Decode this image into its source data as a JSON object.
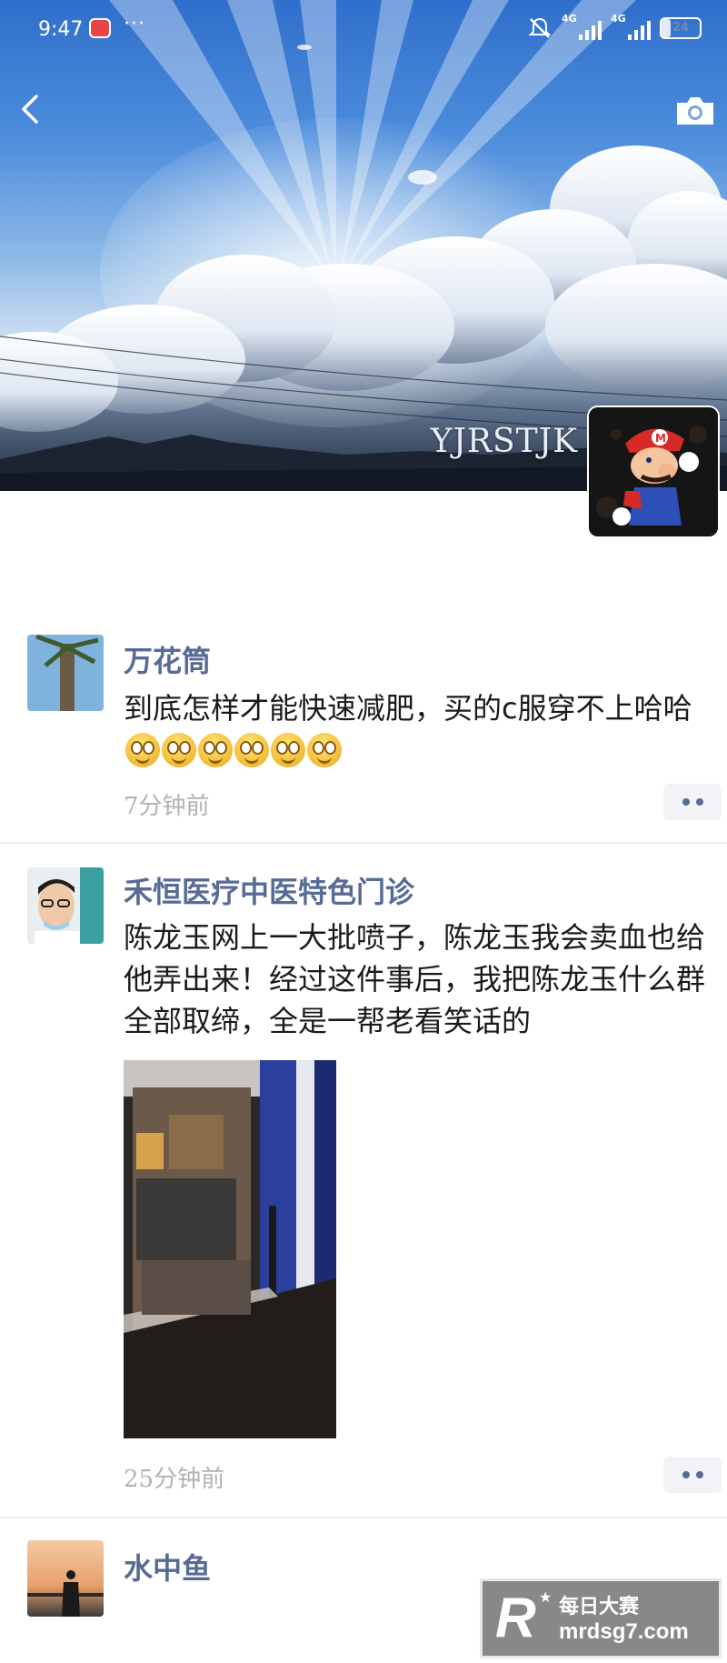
{
  "status_bar": {
    "time": "9:47",
    "dots": "···",
    "network_1": "4G",
    "network_2": "4G",
    "battery": "24"
  },
  "cover": {
    "user_name": "YJRSTJK"
  },
  "posts": [
    {
      "author": "万花筒",
      "text": "到底怎样才能快速减肥，买的c服穿不上哈哈",
      "emoji_count": 6,
      "time": "7分钟前"
    },
    {
      "author": "禾恒医疗中医特色门诊",
      "text": "陈龙玉网上一大批喷子，陈龙玉我会卖血也给他弄出来！经过这件事后，我把陈龙玉什么群全部取缔，全是一帮老看笑话的",
      "time": "25分钟前"
    },
    {
      "author": "水中鱼"
    }
  ],
  "watermark": {
    "logo": "R",
    "title": "每日大赛",
    "url": "mrdsg7.com"
  },
  "colors": {
    "author_link": "#576b95",
    "time_gray": "#b2b2b2",
    "more_button_bg": "#f2f3f7"
  }
}
